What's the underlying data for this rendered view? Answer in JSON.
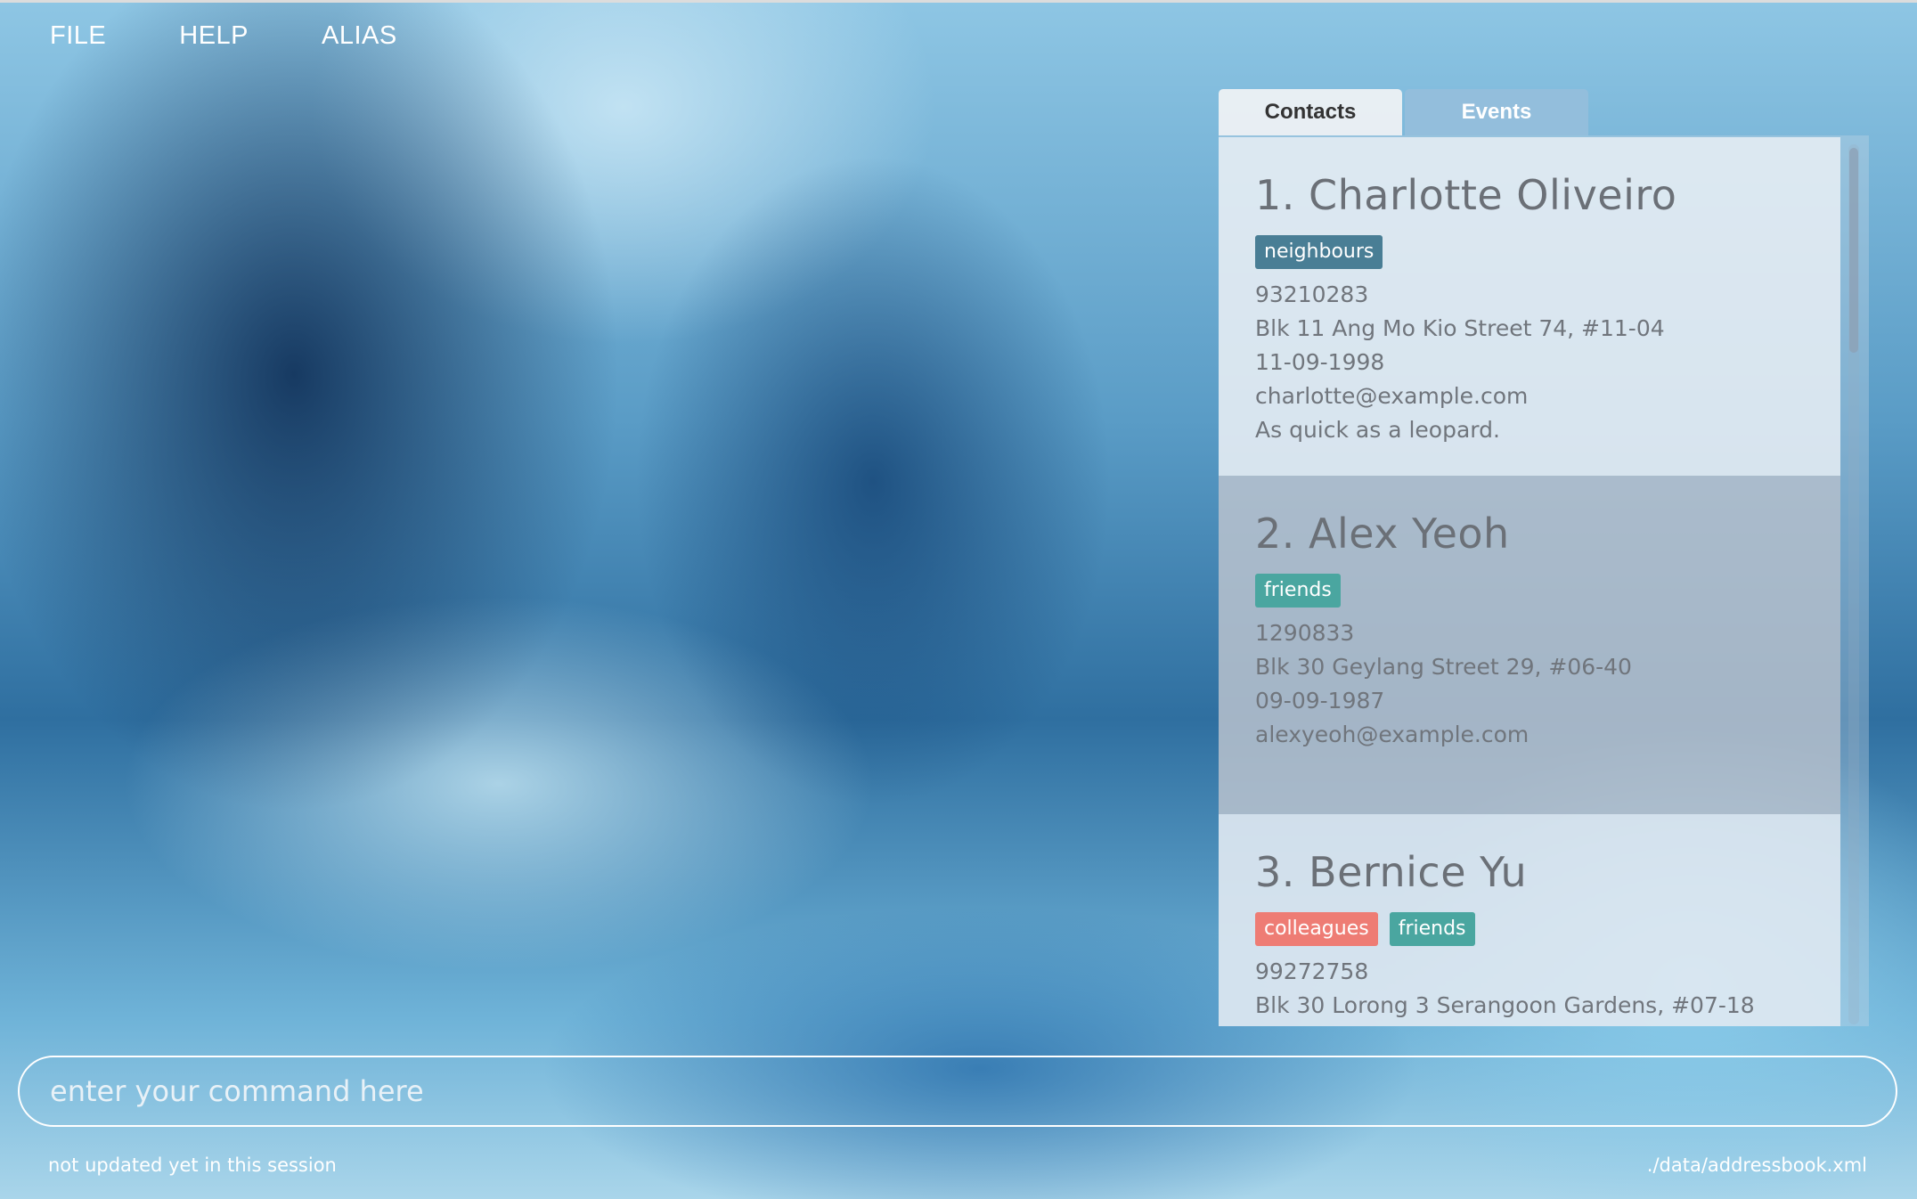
{
  "menu": {
    "file": "FILE",
    "help": "HELP",
    "alias": "ALIAS"
  },
  "tabs": {
    "contacts": "Contacts",
    "events": "Events",
    "active": "Contacts"
  },
  "contacts": [
    {
      "name": "1. Charlotte Oliveiro",
      "tags": [
        {
          "label": "neighbours",
          "color": "#497e95"
        }
      ],
      "phone": "93210283",
      "address": "Blk 11 Ang Mo Kio Street 74, #11-04",
      "birthday": "11-09-1998",
      "email": "charlotte@example.com",
      "remark": "As quick as a leopard."
    },
    {
      "name": "2. Alex Yeoh",
      "tags": [
        {
          "label": "friends",
          "color": "#4aa6a0"
        }
      ],
      "phone": "1290833",
      "address": "Blk 30 Geylang Street 29, #06-40",
      "birthday": "09-09-1987",
      "email": "alexyeoh@example.com"
    },
    {
      "name": "3. Bernice Yu",
      "tags": [
        {
          "label": "colleagues",
          "color": "#ee7c74"
        },
        {
          "label": "friends",
          "color": "#4aa6a0"
        }
      ],
      "phone": "99272758",
      "address": "Blk 30 Lorong 3 Serangoon Gardens, #07-18"
    }
  ],
  "command": {
    "placeholder": "enter your command here",
    "value": ""
  },
  "status": {
    "sync": "not updated yet in this session",
    "file_path": "./data/addressbook.xml"
  }
}
